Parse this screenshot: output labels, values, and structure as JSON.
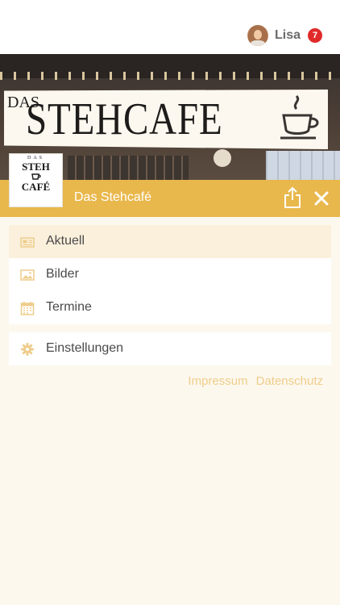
{
  "user": {
    "name": "Lisa",
    "notification_count": "7"
  },
  "hero": {
    "sign_prefix": "DAS",
    "sign_name": "STEHCAFE"
  },
  "logo": {
    "prefix": "DAS",
    "lines": [
      "STEH",
      "CAFÉ"
    ]
  },
  "venue": {
    "title": "Das Stehcafé"
  },
  "menu": {
    "items": [
      {
        "label": "Aktuell",
        "icon": "newspaper-icon",
        "active": true
      },
      {
        "label": "Bilder",
        "icon": "image-icon",
        "active": false
      },
      {
        "label": "Termine",
        "icon": "calendar-icon",
        "active": false
      }
    ],
    "settings": {
      "label": "Einstellungen",
      "icon": "gear-icon"
    }
  },
  "footer_links": {
    "imprint": "Impressum",
    "privacy": "Datenschutz"
  },
  "colors": {
    "accent": "#e9b84c",
    "active_row": "#fbf0dc",
    "badge": "#e02a2a",
    "link": "#eecd8b"
  }
}
